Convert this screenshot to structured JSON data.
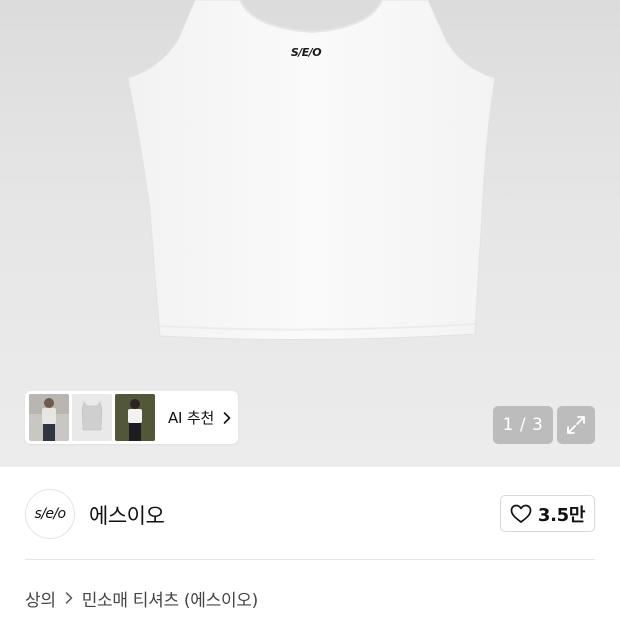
{
  "product_image": {
    "logo_text": "S/E/O",
    "counter": "1 / 3"
  },
  "ai_recommend": {
    "label": "AI 추천"
  },
  "brand": {
    "logo_text": "s/e/o",
    "name": "에스이오",
    "like_count": "3.5만"
  },
  "breadcrumb": {
    "items": [
      "상의",
      "민소매 티셔츠 (에스이오)"
    ]
  },
  "colors": {
    "hero_bg": "#e4e4e4",
    "overlay_button": "#969696",
    "divider": "#e6e6e6"
  },
  "icons": [
    "heart-icon",
    "expand-icon",
    "chevron-right-icon"
  ]
}
